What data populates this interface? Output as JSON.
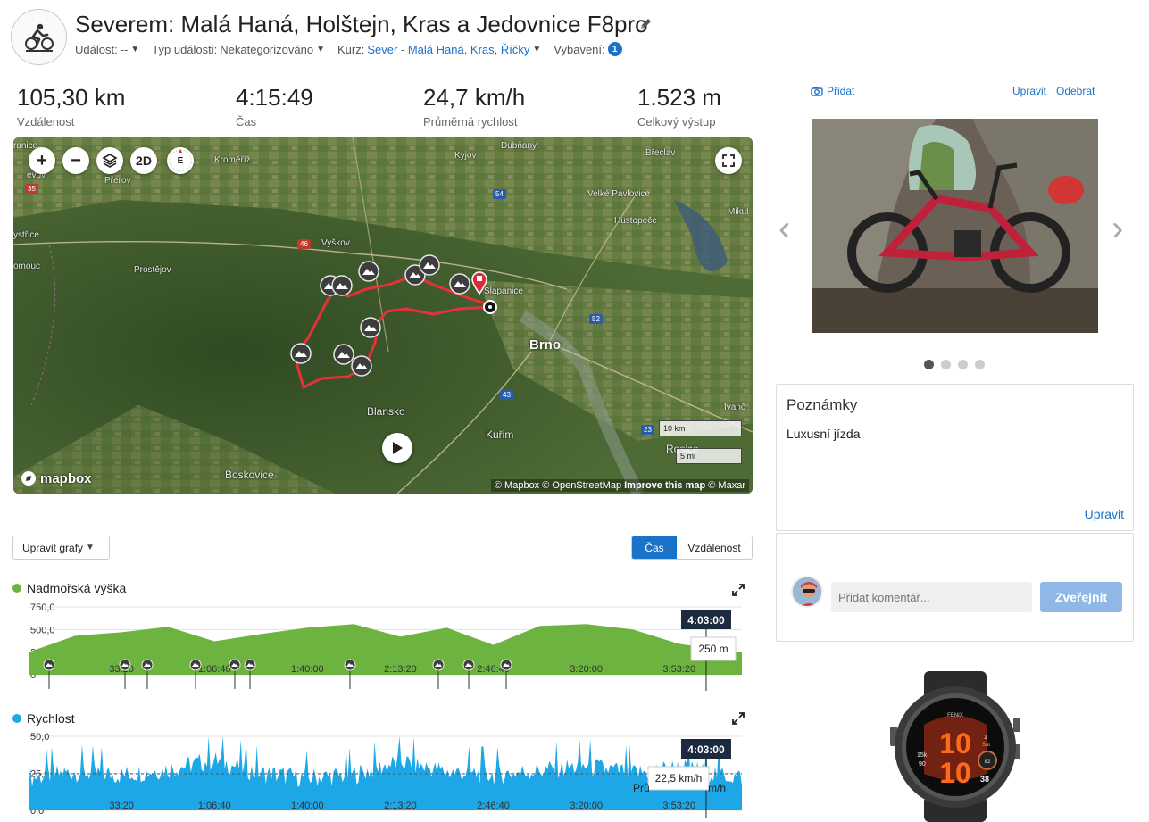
{
  "activity": {
    "title": "Severem: Malá Haná, Holštejn, Kras a Jedovnice F8pro",
    "meta": {
      "event_label": "Událost:",
      "event_value": "--",
      "type_label": "Typ události:",
      "type_value": "Nekategorizováno",
      "course_label": "Kurz:",
      "course_value": "Sever - Malá Haná, Kras, Říčky",
      "gear_label": "Vybavení:",
      "gear_count": "1"
    }
  },
  "stats": [
    {
      "value": "105,30 km",
      "label": "Vzdálenost"
    },
    {
      "value": "4:15:49",
      "label": "Čas"
    },
    {
      "value": "24,7 km/h",
      "label": "Průměrná rychlost"
    },
    {
      "value": "1.523 m",
      "label": "Celkový výstup"
    }
  ],
  "map": {
    "controls": {
      "zoom_in": "+",
      "zoom_out": "−",
      "mode": "2D",
      "compass": "E"
    },
    "cities": {
      "brno": "Brno",
      "blansko": "Blansko",
      "kurim": "Kuřim",
      "boskovice": "Boskovice",
      "slapanice": "Šlapanice"
    },
    "places": {
      "prerov": "Přerov",
      "kromeriz": "Kroměříž",
      "kyjov": "Kyjov",
      "dubnany": "Dubňany",
      "breclav": "Břeclav",
      "velke_pavlovice": "Velké Pavlovice",
      "hustopece": "Hustopeče",
      "mikul": "Mikul",
      "vyskov": "Vyškov",
      "prostejov": "Prostějov",
      "olomouc": "omouc",
      "bystrice": "ystřice",
      "ivanc": "Ivanč",
      "rosice": "Rosice",
      "granice": "ranice",
      "hrevov": "evov"
    },
    "roads": {
      "r35": "35",
      "r46": "46",
      "r54": "54",
      "r52": "52",
      "r43": "43",
      "r23": "23"
    },
    "scale_km": "10 km",
    "scale_mi": "5 mi",
    "logo": "mapbox",
    "attribution_a": "© Mapbox © OpenStreetMap",
    "attribution_b": "Improve this map",
    "attribution_c": "© Maxar"
  },
  "charts_controls": {
    "edit_label": "Upravit grafy",
    "toggle_time": "Čas",
    "toggle_distance": "Vzdálenost"
  },
  "elevation_chart": {
    "title": "Nadmořská výška",
    "color": "#6cb33f",
    "y_ticks": [
      "750,0",
      "500,0",
      "250,0",
      "0"
    ],
    "x_ticks": [
      "33:20",
      "1:06:40",
      "1:40:00",
      "2:13:20",
      "2:46:40",
      "3:20:00",
      "3:53:20"
    ],
    "cursor_time": "4:03:00",
    "cursor_value": "250 m"
  },
  "speed_chart": {
    "title": "Rychlost",
    "color": "#1ea7e6",
    "y_ticks": [
      "50,0",
      "25,0",
      "0,0"
    ],
    "x_ticks": [
      "33:20",
      "1:06:40",
      "1:40:00",
      "2:13:20",
      "2:46:40",
      "3:20:00",
      "3:53:20"
    ],
    "cursor_time": "4:03:00",
    "cursor_value": "22,5 km/h",
    "avg_hint_left": "Prů",
    "avg_hint_right": "m/h"
  },
  "chart_data": [
    {
      "type": "area",
      "title": "Nadmořská výška",
      "x_unit": "time",
      "ylim": [
        0,
        750
      ],
      "x": [
        "0:00",
        "0:16:40",
        "0:33:20",
        "0:50:00",
        "1:06:40",
        "1:23:20",
        "1:40:00",
        "1:56:40",
        "2:13:20",
        "2:30:00",
        "2:46:40",
        "3:03:20",
        "3:20:00",
        "3:36:40",
        "3:53:20",
        "4:15:49"
      ],
      "values": [
        250,
        430,
        470,
        530,
        370,
        450,
        520,
        560,
        420,
        520,
        330,
        540,
        560,
        500,
        340,
        250
      ],
      "series": [
        {
          "name": "Nadmořská výška",
          "values": [
            250,
            430,
            470,
            530,
            370,
            450,
            520,
            560,
            420,
            520,
            330,
            540,
            560,
            500,
            340,
            250
          ]
        }
      ]
    },
    {
      "type": "area",
      "title": "Rychlost",
      "x_unit": "time",
      "ylim": [
        0,
        50
      ],
      "x": [
        "0:00",
        "0:16:40",
        "0:33:20",
        "0:50:00",
        "1:06:40",
        "1:23:20",
        "1:40:00",
        "1:56:40",
        "2:13:20",
        "2:30:00",
        "2:46:40",
        "3:03:20",
        "3:20:00",
        "3:36:40",
        "3:53:20",
        "4:15:49"
      ],
      "values": [
        22,
        26,
        24,
        28,
        34,
        25,
        22,
        24,
        33,
        26,
        24,
        27,
        30,
        25,
        29,
        22
      ],
      "series": [
        {
          "name": "Rychlost",
          "values": [
            22,
            26,
            24,
            28,
            34,
            25,
            22,
            24,
            33,
            26,
            24,
            27,
            30,
            25,
            29,
            22
          ]
        }
      ]
    }
  ],
  "photos": {
    "add_label": "Přidat",
    "edit_label": "Upravit",
    "remove_label": "Odebrat",
    "count": 4,
    "active_index": 0
  },
  "notes": {
    "heading": "Poznámky",
    "text": "Luxusní jízda",
    "edit_label": "Upravit"
  },
  "comments": {
    "placeholder": "Přidat komentář...",
    "publish_label": "Zveřejnit"
  },
  "watch": {
    "brand": "FENIX",
    "time_hours": "10",
    "time_minutes": "10",
    "left_top": "15k",
    "left_bottom": "90",
    "right_top": "1",
    "right_day": "Sat",
    "right_mid": "82",
    "right_bottom": "38"
  }
}
